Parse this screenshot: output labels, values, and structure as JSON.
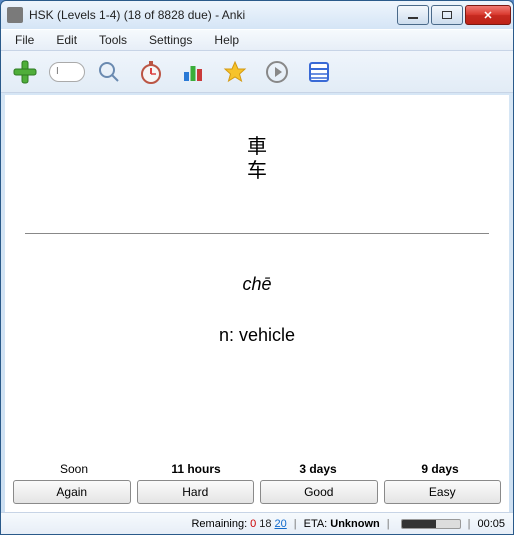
{
  "window": {
    "title": "HSK (Levels 1-4) (18 of 8828 due) - Anki"
  },
  "menu": {
    "file": "File",
    "edit": "Edit",
    "tools": "Tools",
    "settings": "Settings",
    "help": "Help"
  },
  "toolbar": {
    "deck_placeholder": "I"
  },
  "card": {
    "front_l1": "車",
    "front_l2": "车",
    "pinyin": "chē",
    "definition": "n: vehicle"
  },
  "intervals": {
    "col0": "Soon",
    "col1": "11 hours",
    "col2": "3 days",
    "col3": "9 days"
  },
  "buttons": {
    "again": "Again",
    "hard": "Hard",
    "good": "Good",
    "easy": "Easy"
  },
  "status": {
    "remaining_label": "Remaining:",
    "r0": "0",
    "r1": "18",
    "r2": "20",
    "eta_label": "ETA:",
    "eta_value": "Unknown",
    "time": "00:05"
  }
}
